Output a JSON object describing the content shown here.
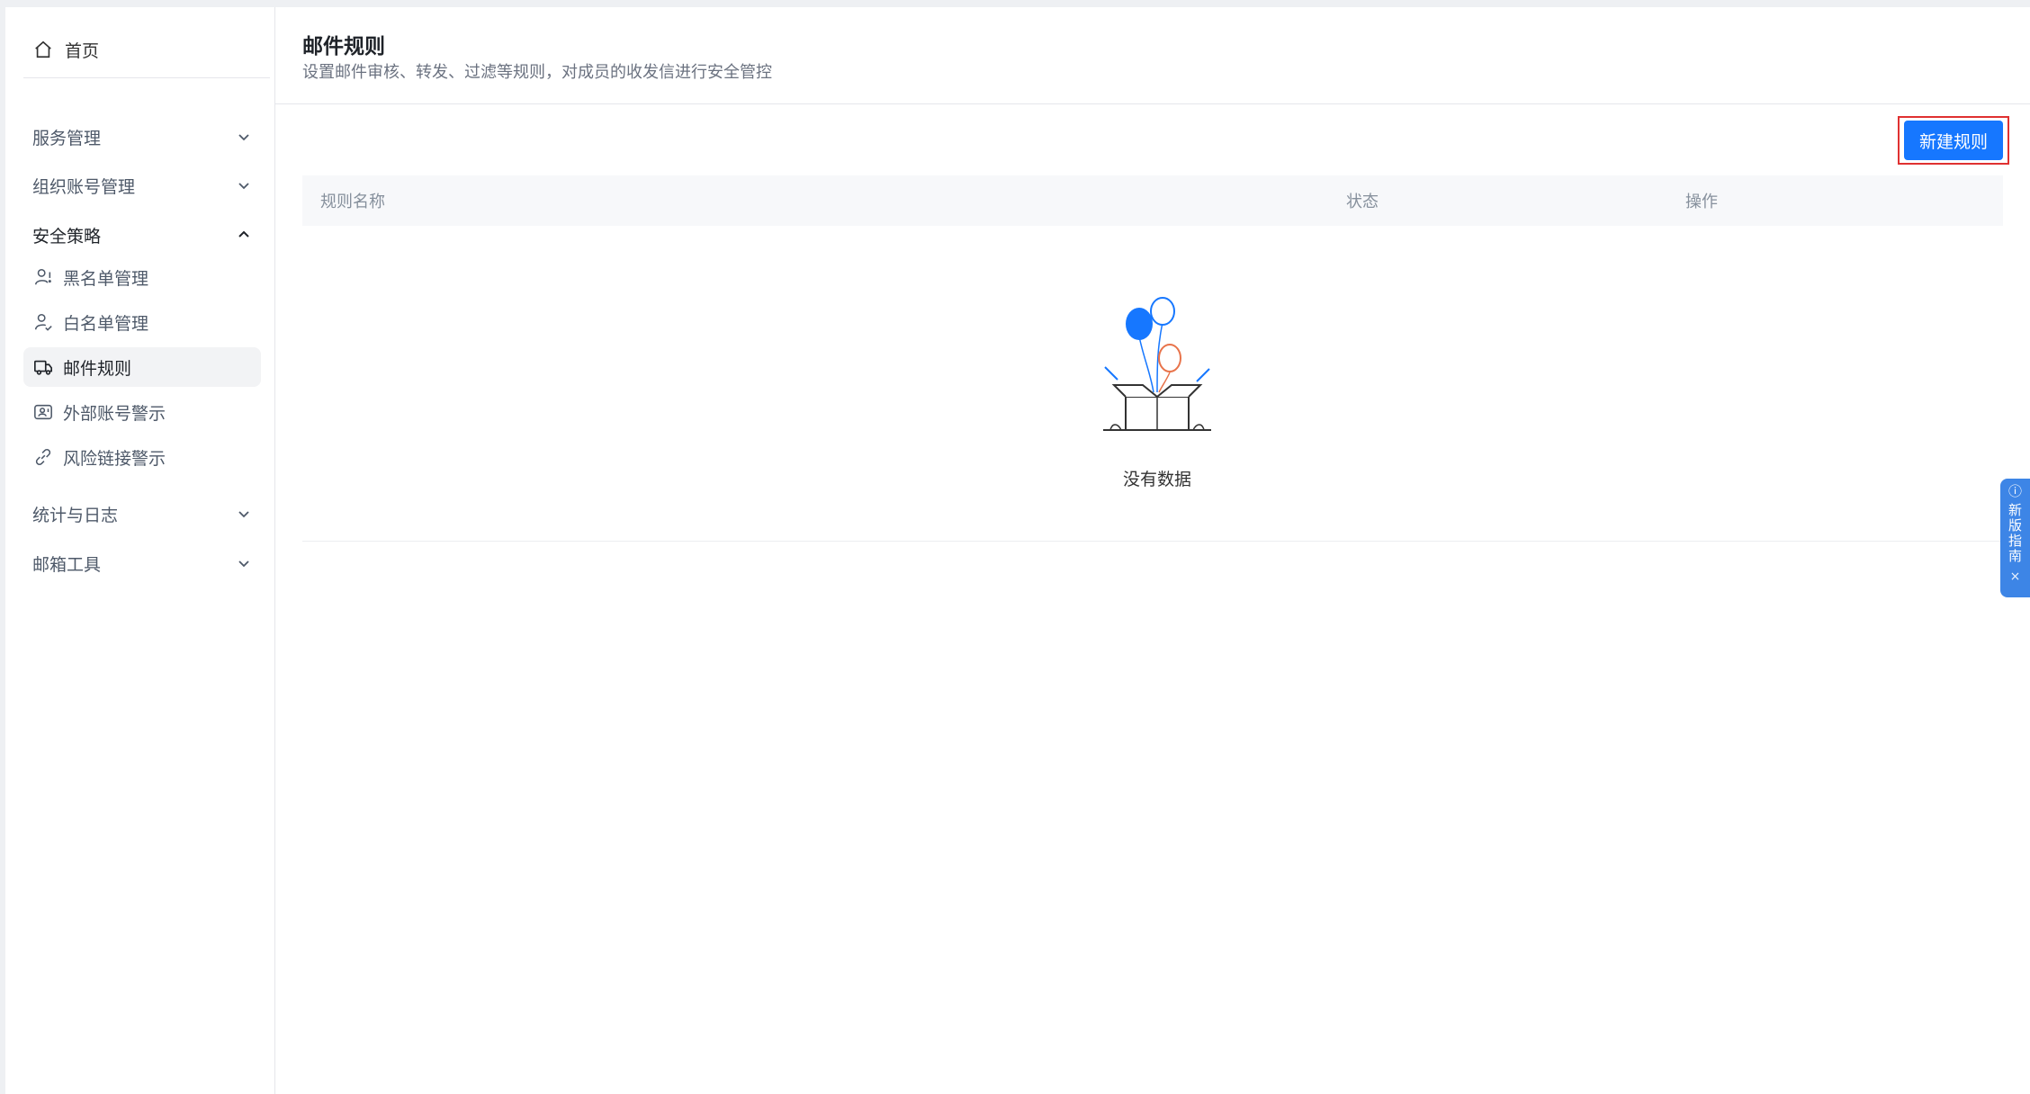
{
  "sidebar": {
    "home": {
      "label": "首页",
      "icon": "home-icon"
    },
    "groups": [
      {
        "label": "服务管理",
        "expanded": false
      },
      {
        "label": "组织账号管理",
        "expanded": false
      },
      {
        "label": "安全策略",
        "expanded": true
      },
      {
        "label": "统计与日志",
        "expanded": false
      },
      {
        "label": "邮箱工具",
        "expanded": false
      }
    ],
    "security_items": [
      {
        "label": "黑名单管理",
        "icon": "user-block-icon",
        "active": false
      },
      {
        "label": "白名单管理",
        "icon": "user-check-icon",
        "active": false
      },
      {
        "label": "邮件规则",
        "icon": "mail-rule-icon",
        "active": true
      },
      {
        "label": "外部账号警示",
        "icon": "external-account-icon",
        "active": false
      },
      {
        "label": "风险链接警示",
        "icon": "link-icon",
        "active": false
      }
    ]
  },
  "header": {
    "title": "邮件规则",
    "description": "设置邮件审核、转发、过滤等规则，对成员的收发信进行安全管控"
  },
  "toolbar": {
    "new_rule_label": "新建规则"
  },
  "table": {
    "columns": [
      "规则名称",
      "状态",
      "操作"
    ],
    "rows": [],
    "empty_text": "没有数据"
  },
  "guide": {
    "label": "新版指南",
    "info_icon": "ⓘ",
    "close_icon": "×"
  },
  "colors": {
    "primary": "#1677ff",
    "highlight_border": "#e03131",
    "guide_bg": "#3d85e6"
  }
}
